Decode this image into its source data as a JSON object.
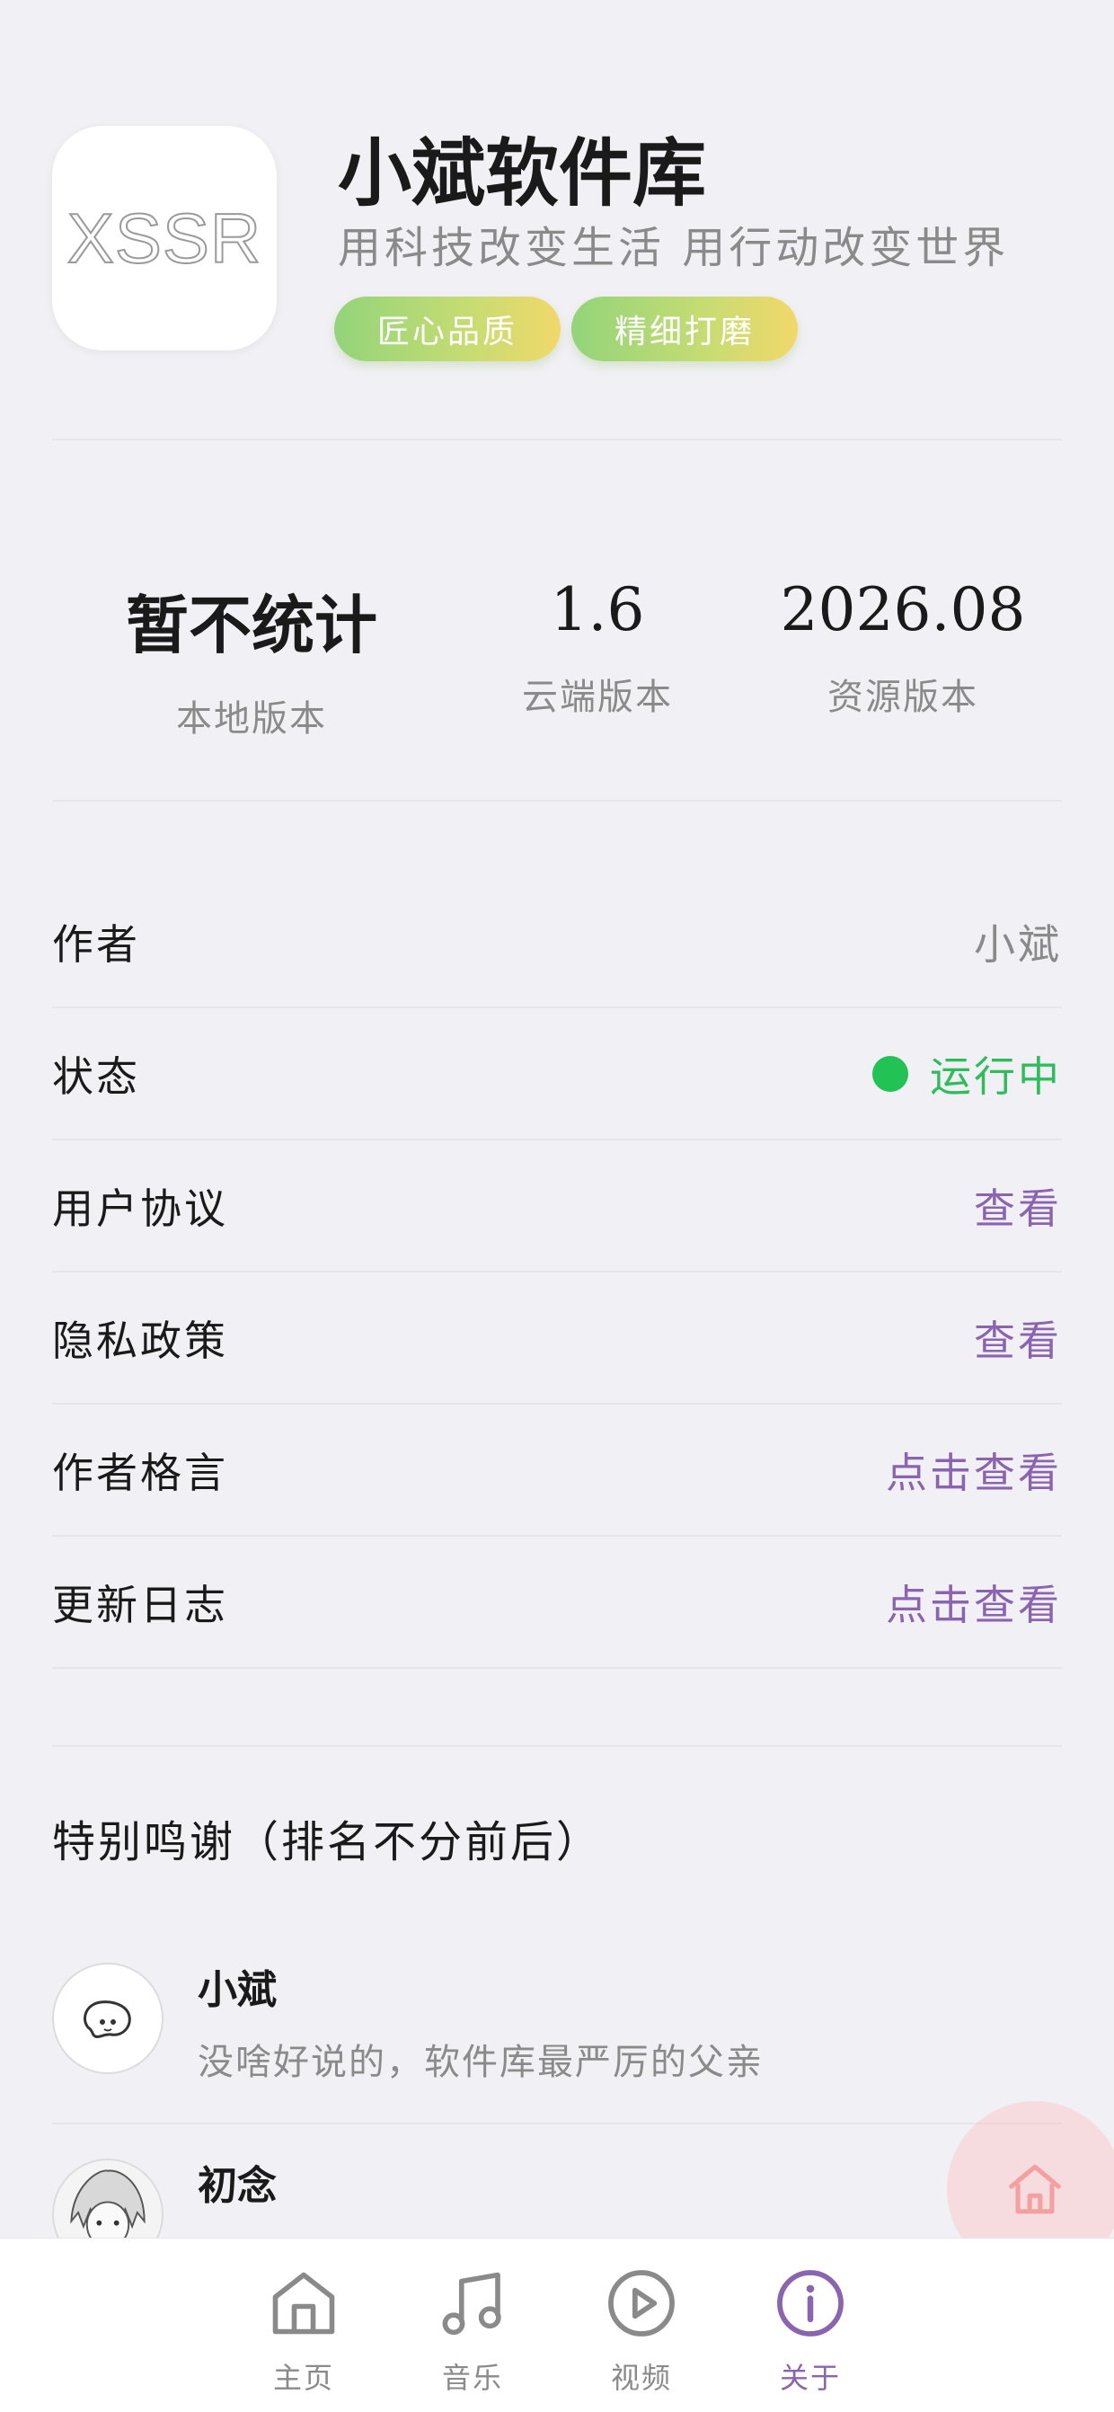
{
  "app": {
    "logo_text": "XSSR",
    "title": "小斌软件库",
    "slogan": "用科技改变生活 用行动改变世界",
    "tags": [
      "匠心品质",
      "精细打磨"
    ]
  },
  "stats": [
    {
      "value": "暂不统计",
      "label": "本地版本"
    },
    {
      "value": "1.6",
      "label": "云端版本"
    },
    {
      "value": "2026.08",
      "label": "资源版本"
    }
  ],
  "info_rows": [
    {
      "label": "作者",
      "value": "小斌"
    },
    {
      "label": "状态",
      "value": "运行中",
      "status_color": "#23c254"
    },
    {
      "label": "用户协议",
      "value": "查看"
    },
    {
      "label": "隐私政策",
      "value": "查看"
    },
    {
      "label": "作者格言",
      "value": "点击查看"
    },
    {
      "label": "更新日志",
      "value": "点击查看"
    }
  ],
  "thanks": {
    "title": "特别鸣谢（排名不分前后）",
    "people": [
      {
        "name": "小斌",
        "desc": "没啥好说的，软件库最严厉的父亲",
        "avatar_icon": "doodle-avatar-icon"
      },
      {
        "name": "初念",
        "desc": "",
        "avatar_icon": "anime-avatar-icon"
      }
    ]
  },
  "tabbar": {
    "items": [
      {
        "label": "主页",
        "icon": "home-icon"
      },
      {
        "label": "音乐",
        "icon": "music-note-icon"
      },
      {
        "label": "视频",
        "icon": "play-circle-icon"
      },
      {
        "label": "关于",
        "icon": "info-circle-icon",
        "active": true
      }
    ]
  },
  "colors": {
    "accent": "#8a64b0",
    "status_green": "#23c254",
    "background": "#f1f0f5"
  }
}
